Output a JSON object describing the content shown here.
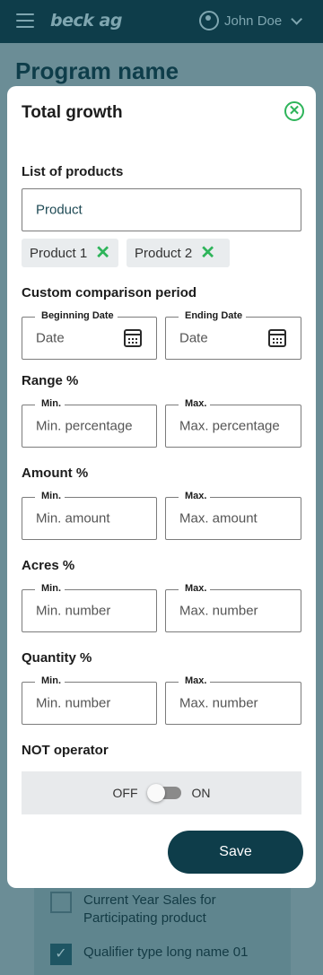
{
  "header": {
    "logo": "beck ag",
    "user_name": "John Doe"
  },
  "page": {
    "title": "Program name"
  },
  "background_list": [
    {
      "label": "Current Year Sales for Participating product",
      "checked": false
    },
    {
      "label": "Qualifier type long name 01",
      "checked": true
    }
  ],
  "modal": {
    "title": "Total growth",
    "products": {
      "label": "List of products",
      "placeholder": "Product",
      "chips": [
        "Product 1",
        "Product 2"
      ]
    },
    "comparison": {
      "label": "Custom comparison period",
      "begin_legend": "Beginning Date",
      "begin_placeholder": "Date",
      "end_legend": "Ending Date",
      "end_placeholder": "Date"
    },
    "range": {
      "label": "Range %",
      "min_legend": "Min.",
      "min_placeholder": "Min. percentage",
      "max_legend": "Max.",
      "max_placeholder": "Max. percentage"
    },
    "amount": {
      "label": "Amount %",
      "min_legend": "Min.",
      "min_placeholder": "Min. amount",
      "max_legend": "Max.",
      "max_placeholder": "Max. amount"
    },
    "acres": {
      "label": "Acres %",
      "min_legend": "Min.",
      "min_placeholder": "Min. number",
      "max_legend": "Max.",
      "max_placeholder": "Max. number"
    },
    "quantity": {
      "label": "Quantity %",
      "min_legend": "Min.",
      "min_placeholder": "Min. number",
      "max_legend": "Max.",
      "max_placeholder": "Max. number"
    },
    "not_operator": {
      "label": "NOT operator",
      "off_label": "OFF",
      "on_label": "ON",
      "state": "off"
    },
    "save_label": "Save"
  },
  "colors": {
    "primary": "#0e3d4a",
    "accent": "#2eb45a",
    "overlay": "#6b8d96"
  }
}
